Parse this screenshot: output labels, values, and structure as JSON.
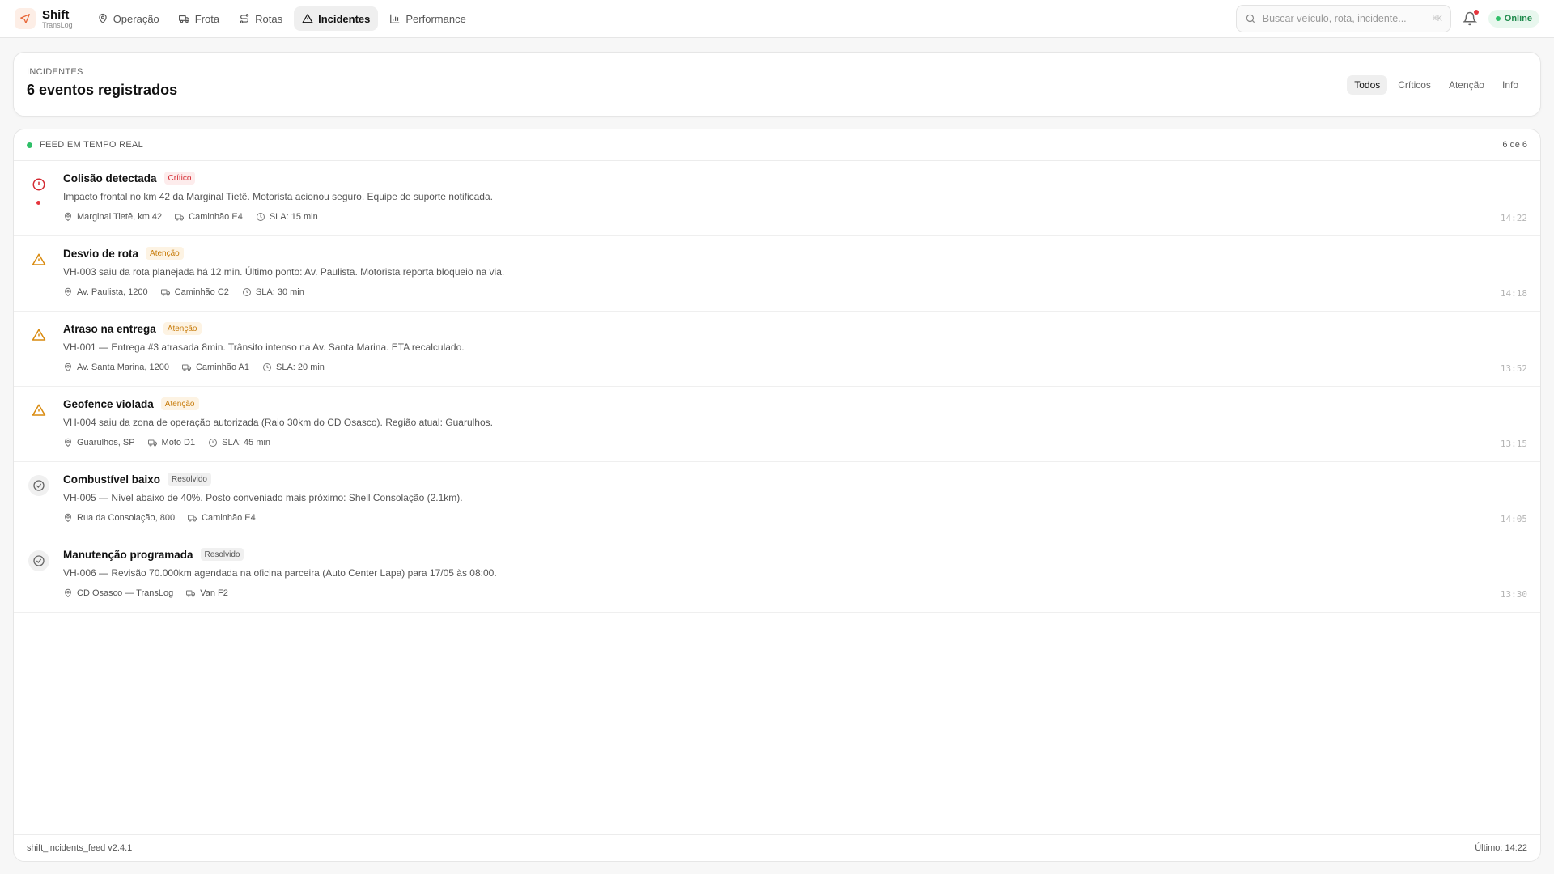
{
  "app": {
    "name": "Shift",
    "subtitle": "TransLog",
    "accent": "#e8683a"
  },
  "nav": [
    {
      "label": "Operação",
      "icon": "map-pin-icon",
      "active": false
    },
    {
      "label": "Frota",
      "icon": "truck-icon",
      "active": false
    },
    {
      "label": "Rotas",
      "icon": "route-icon",
      "active": false
    },
    {
      "label": "Incidentes",
      "icon": "alert-triangle-icon",
      "active": true
    },
    {
      "label": "Performance",
      "icon": "bar-chart-icon",
      "active": false
    }
  ],
  "search": {
    "placeholder": "Buscar veículo, rota, incidente...",
    "shortcut": "⌘K"
  },
  "status": {
    "label": "Online",
    "color": "#2fbf68"
  },
  "header": {
    "eyebrow": "INCIDENTES",
    "title": "6 eventos registrados",
    "filters": [
      {
        "label": "Todos",
        "active": true
      },
      {
        "label": "Críticos",
        "active": false
      },
      {
        "label": "Atenção",
        "active": false
      },
      {
        "label": "Info",
        "active": false
      }
    ]
  },
  "feed": {
    "label": "FEED EM TEMPO REAL",
    "count": "6 de 6",
    "footer_version": "shift_incidents_feed v2.4.1",
    "footer_last": "Último: 14:22",
    "items": [
      {
        "title": "Colisão detectada",
        "badge": "Crítico",
        "severity": "critical",
        "icon": "alert-circle-icon",
        "unread": true,
        "description": "Impacto frontal no km 42 da Marginal Tietê. Motorista acionou seguro. Equipe de suporte notificada.",
        "location": "Marginal Tietê, km 42",
        "vehicle": "Caminhão E4",
        "sla": "SLA: 15 min",
        "time": "14:22"
      },
      {
        "title": "Desvio de rota",
        "badge": "Atenção",
        "severity": "warning",
        "icon": "alert-triangle-icon",
        "unread": false,
        "description": "VH-003 saiu da rota planejada há 12 min. Último ponto: Av. Paulista. Motorista reporta bloqueio na via.",
        "location": "Av. Paulista, 1200",
        "vehicle": "Caminhão C2",
        "sla": "SLA: 30 min",
        "time": "14:18"
      },
      {
        "title": "Atraso na entrega",
        "badge": "Atenção",
        "severity": "warning",
        "icon": "alert-triangle-icon",
        "unread": false,
        "description": "VH-001 — Entrega #3 atrasada 8min. Trânsito intenso na Av. Santa Marina. ETA recalculado.",
        "location": "Av. Santa Marina, 1200",
        "vehicle": "Caminhão A1",
        "sla": "SLA: 20 min",
        "time": "13:52"
      },
      {
        "title": "Geofence violada",
        "badge": "Atenção",
        "severity": "warning",
        "icon": "alert-triangle-icon",
        "unread": false,
        "description": "VH-004 saiu da zona de operação autorizada (Raio 30km do CD Osasco). Região atual: Guarulhos.",
        "location": "Guarulhos, SP",
        "vehicle": "Moto D1",
        "sla": "SLA: 45 min",
        "time": "13:15"
      },
      {
        "title": "Combustível baixo",
        "badge": "Resolvido",
        "severity": "resolved",
        "icon": "check-circle-icon",
        "unread": false,
        "description": "VH-005 — Nível abaixo de 40%. Posto conveniado mais próximo: Shell Consolação (2.1km).",
        "location": "Rua da Consolação, 800",
        "vehicle": "Caminhão E4",
        "sla": "",
        "time": "14:05"
      },
      {
        "title": "Manutenção programada",
        "badge": "Resolvido",
        "severity": "resolved",
        "icon": "check-circle-icon",
        "unread": false,
        "description": "VH-006 — Revisão 70.000km agendada na oficina parceira (Auto Center Lapa) para 17/05 às 08:00.",
        "location": "CD Osasco — TransLog",
        "vehicle": "Van F2",
        "sla": "",
        "time": "13:30"
      }
    ]
  },
  "colors": {
    "critical": "#d42b33",
    "warning": "#d98a0e",
    "resolved": "#666666"
  }
}
